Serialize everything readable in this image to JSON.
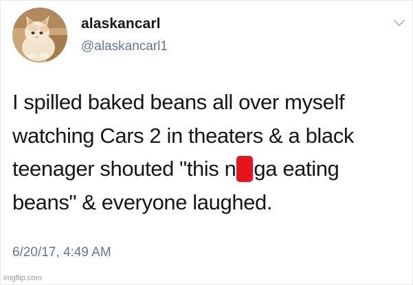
{
  "tweet": {
    "display_name": "alaskancarl",
    "handle": "@alaskancarl1",
    "text_line1": "I spilled baked beans all over myself",
    "text_line2": "watching Cars 2 in theaters & a black",
    "text_line3_before": "teenager shouted \"this n",
    "text_line3_after": "ga eating",
    "text_line4": "beans\" & everyone laughed.",
    "timestamp": "6/20/17, 4:49 AM"
  },
  "icons": {
    "avatar": "cat-photo-avatar",
    "menu": "chevron-down-icon"
  },
  "colors": {
    "text_primary": "#14171a",
    "text_secondary": "#657786",
    "redaction": "#e8121d"
  },
  "watermark": "imgflip.com"
}
